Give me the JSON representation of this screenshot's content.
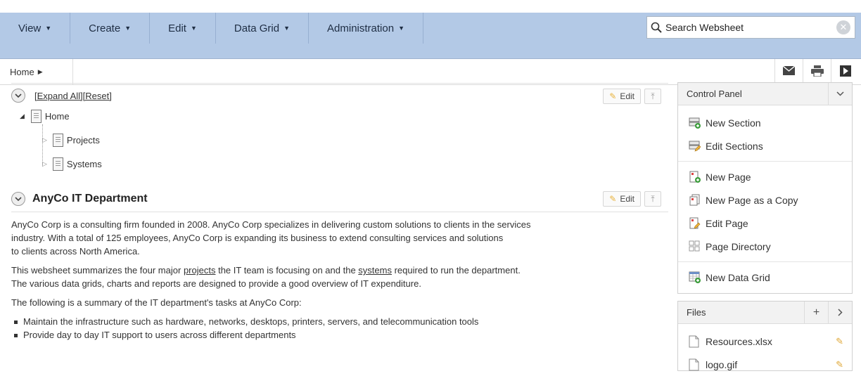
{
  "menu": {
    "items": [
      {
        "label": "View"
      },
      {
        "label": "Create"
      },
      {
        "label": "Edit"
      },
      {
        "label": "Data Grid"
      },
      {
        "label": "Administration"
      }
    ]
  },
  "search": {
    "placeholder": "Search Websheet"
  },
  "breadcrumb": {
    "label": "Home"
  },
  "tree_region": {
    "expand_all": "[Expand All]",
    "reset": "[Reset]",
    "edit_label": "Edit",
    "nodes": {
      "root": "Home",
      "child1": "Projects",
      "child2": "Systems"
    }
  },
  "section": {
    "title": "AnyCo IT Department",
    "edit_label": "Edit",
    "para1_line1": "AnyCo Corp is a consulting firm founded in 2008. AnyCo Corp specializes in delivering custom solutions to clients in the services",
    "para1_line2": "industry. With a total of 125 employees, AnyCo Corp is expanding its business to extend consulting services and solutions",
    "para1_line3": "to clients across North America.",
    "para2_a": "This websheet summarizes the four major ",
    "para2_link1": "projects",
    "para2_b": " the IT team is focusing on and the ",
    "para2_link2": "systems",
    "para2_c": " required to run the department.",
    "para2_line2": "The various data grids, charts and reports are designed to provide a good overview of IT expenditure.",
    "para3": "The following is a summary of the IT department's tasks at AnyCo Corp:",
    "bullets": [
      "Maintain the infrastructure such as hardware, networks, desktops, printers, servers, and telecommunication tools",
      "Provide day to day IT support to users across different departments"
    ]
  },
  "control_panel": {
    "title": "Control Panel",
    "items": {
      "new_section": "New Section",
      "edit_sections": "Edit Sections",
      "new_page": "New Page",
      "new_page_copy": "New Page as a Copy",
      "edit_page": "Edit Page",
      "page_directory": "Page Directory",
      "new_data_grid": "New Data Grid"
    }
  },
  "files_panel": {
    "title": "Files",
    "files": [
      "Resources.xlsx",
      "logo.gif"
    ]
  }
}
